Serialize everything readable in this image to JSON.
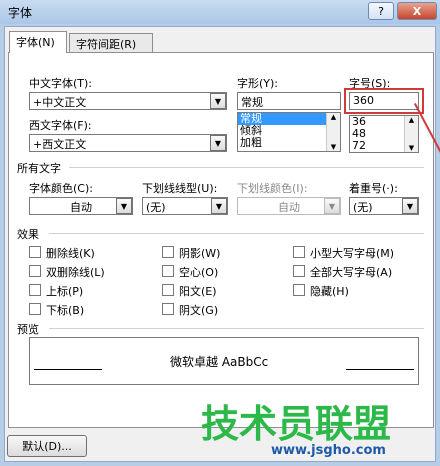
{
  "window": {
    "title": "字体",
    "help_label": "?",
    "close_label": "X"
  },
  "tabs": [
    {
      "label": "字体(N)"
    },
    {
      "label": "字符间距(R)"
    }
  ],
  "font": {
    "chinese_label": "中文字体(T):",
    "chinese_value": "+中文正文",
    "western_label": "西文字体(F):",
    "western_value": "+西文正文",
    "style_label": "字形(Y):",
    "style_value": "常规",
    "style_options": [
      "常规",
      "倾斜",
      "加粗"
    ],
    "size_label": "字号(S):",
    "size_value": "360",
    "size_options": [
      "36",
      "48",
      "72"
    ]
  },
  "all_text": {
    "section_label": "所有文字",
    "color_label": "字体颜色(C):",
    "color_value": "自动",
    "underline_label": "下划线线型(U):",
    "underline_value": "(无)",
    "underline_color_label": "下划线颜色(I):",
    "underline_color_value": "自动",
    "emphasis_label": "着重号(·):",
    "emphasis_value": "(无)"
  },
  "effects": {
    "section_label": "效果",
    "col1": [
      "删除线(K)",
      "双删除线(L)",
      "上标(P)",
      "下标(B)"
    ],
    "col2": [
      "阴影(W)",
      "空心(O)",
      "阳文(E)",
      "阴文(G)"
    ],
    "col3": [
      "小型大写字母(M)",
      "全部大写字母(A)",
      "隐藏(H)"
    ]
  },
  "preview": {
    "section_label": "预览",
    "sample_text": "微软卓越 AaBbCc"
  },
  "footer": {
    "default_label": "默认(D)..."
  },
  "watermark": {
    "brand": "技术员联盟",
    "url": "www.jsgho.com"
  },
  "colors": {
    "highlight": "#d03a3a",
    "accent": "#3399ff"
  }
}
